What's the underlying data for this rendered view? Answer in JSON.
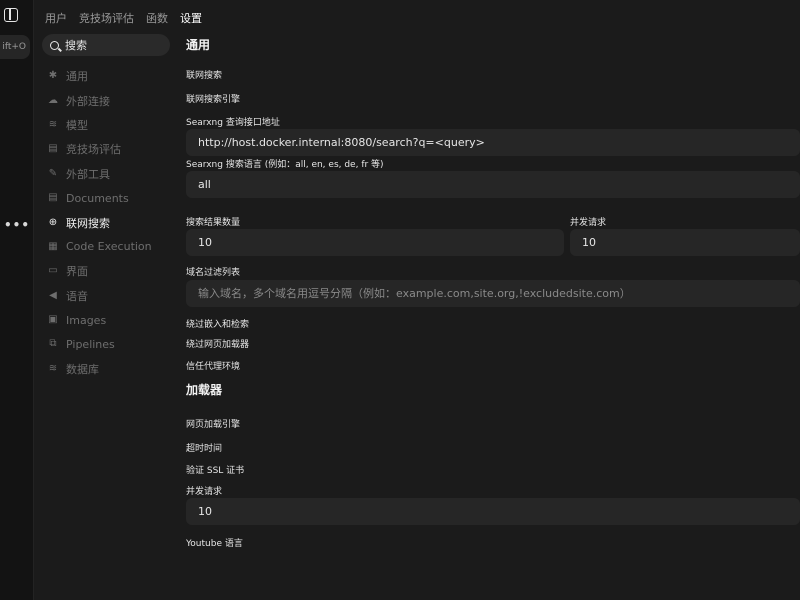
{
  "rail": {
    "shortcut": "ift+O",
    "more": "•••"
  },
  "tabs": [
    {
      "label": "用户"
    },
    {
      "label": "竞技场评估"
    },
    {
      "label": "函数"
    },
    {
      "label": "设置"
    }
  ],
  "search": {
    "placeholder": "搜索"
  },
  "sidebar": {
    "items": [
      {
        "label": "通用",
        "icon": "gear-icon"
      },
      {
        "label": "外部连接",
        "icon": "cloud-icon"
      },
      {
        "label": "模型",
        "icon": "database-icon"
      },
      {
        "label": "竞技场评估",
        "icon": "document-icon"
      },
      {
        "label": "外部工具",
        "icon": "wrench-icon"
      },
      {
        "label": "Documents",
        "icon": "document-icon"
      },
      {
        "label": "联网搜索",
        "icon": "globe-icon"
      },
      {
        "label": "Code Execution",
        "icon": "code-icon"
      },
      {
        "label": "界面",
        "icon": "monitor-icon"
      },
      {
        "label": "语音",
        "icon": "speaker-icon"
      },
      {
        "label": "Images",
        "icon": "image-icon"
      },
      {
        "label": "Pipelines",
        "icon": "pipeline-icon"
      },
      {
        "label": "数据库",
        "icon": "database-icon"
      }
    ]
  },
  "main": {
    "general_title": "通用",
    "web_search_label": "联网搜索",
    "web_search_engine_label": "联网搜索引擎",
    "searxng_url_label": "Searxng 查询接口地址",
    "searxng_url_value": "http://host.docker.internal:8080/search?q=<query>",
    "searxng_lang_label": "Searxng 搜索语言 (例如：all, en, es, de, fr 等)",
    "searxng_lang_value": "all",
    "result_count_label": "搜索结果数量",
    "result_count_value": "10",
    "concurrent_label": "并发请求",
    "concurrent_value": "10",
    "domain_filter_label": "域名过滤列表",
    "domain_filter_placeholder": "输入域名，多个域名用逗号分隔（例如：example.com,site.org,!excludedsite.com）",
    "bypass_embed_label": "绕过嵌入和检索",
    "bypass_loader_label": "绕过网页加载器",
    "trust_proxy_label": "信任代理环境",
    "loader_title": "加载器",
    "web_loader_engine_label": "网页加载引擎",
    "timeout_label": "超时时间",
    "verify_ssl_label": "验证 SSL 证书",
    "loader_concurrent_label": "并发请求",
    "loader_concurrent_value": "10",
    "youtube_lang_label": "Youtube 语言"
  }
}
